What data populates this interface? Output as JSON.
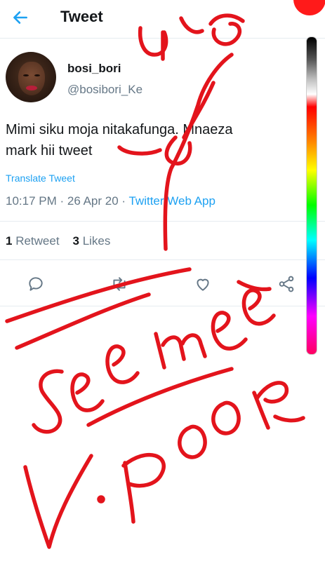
{
  "header": {
    "title": "Tweet",
    "back_icon": "arrow-left-icon",
    "accent": "#1da1f2"
  },
  "tweet": {
    "display_name": "bosi_bori",
    "handle": "@bosibori_Ke",
    "text_line1": "Mimi siku moja nitakafunga. Mnaeza",
    "text_line2": "mark hii tweet",
    "translate_label": "Translate Tweet",
    "time": "10:17 PM",
    "separator1": " · ",
    "date": "26 Apr 20",
    "separator2": " · ",
    "client": "Twitter Web App",
    "retweet_count": "1",
    "retweet_label": "Retweet",
    "like_count": "3",
    "like_label": "Likes"
  },
  "actions": [
    {
      "icon": "reply-icon"
    },
    {
      "icon": "retweet-icon"
    },
    {
      "icon": "like-icon"
    },
    {
      "icon": "share-icon"
    }
  ],
  "drawing": {
    "ink_color": "#e3141c",
    "scrawl_words": [
      "See me",
      "V. Poor"
    ]
  }
}
